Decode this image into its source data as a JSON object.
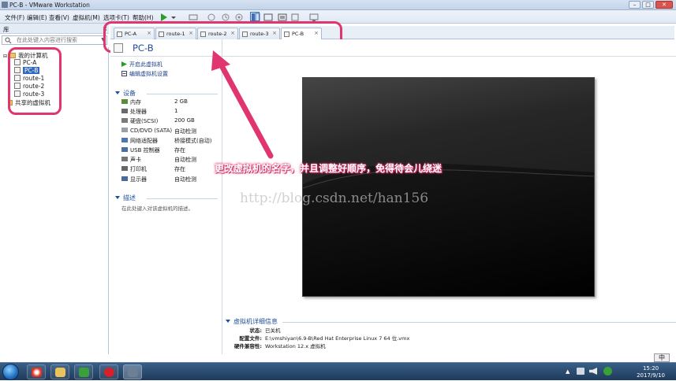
{
  "window": {
    "title": "PC-B - VMware Workstation"
  },
  "menu": [
    "文件(F)",
    "编辑(E)",
    "查看(V)",
    "虚拟机(M)",
    "选项卡(T)",
    "帮助(H)"
  ],
  "sidebar": {
    "header": "库",
    "close": "×",
    "search_placeholder": "在此处键入内容进行搜索",
    "root": "我的计算机",
    "vms": [
      "PC-A",
      "PC-B",
      "route-1",
      "route-2",
      "route-3"
    ],
    "selected": "PC-B",
    "shared": "共享的虚拟机"
  },
  "tabs": [
    {
      "label": "PC-A",
      "close": "×"
    },
    {
      "label": "route-1",
      "close": "×"
    },
    {
      "label": "route-2",
      "close": "×"
    },
    {
      "label": "route-3",
      "close": "×"
    },
    {
      "label": "PC-B",
      "close": "×",
      "active": true
    }
  ],
  "vm": {
    "name": "PC-B",
    "actions": [
      "开启此虚拟机",
      "编辑虚拟机设置"
    ],
    "devices_title": "设备",
    "devices": [
      {
        "icon": "memory-icon",
        "name": "内存",
        "value": "2 GB"
      },
      {
        "icon": "cpu-icon",
        "name": "处理器",
        "value": "1"
      },
      {
        "icon": "hdd-icon",
        "name": "硬盘(SCSI)",
        "value": "200 GB"
      },
      {
        "icon": "cdrom-icon",
        "name": "CD/DVD (SATA)",
        "value": "自动检测"
      },
      {
        "icon": "network-icon",
        "name": "网络适配器",
        "value": "桥接模式(自动)"
      },
      {
        "icon": "usb-icon",
        "name": "USB 控制器",
        "value": "存在"
      },
      {
        "icon": "sound-icon",
        "name": "声卡",
        "value": "自动检测"
      },
      {
        "icon": "printer-icon",
        "name": "打印机",
        "value": "存在"
      },
      {
        "icon": "display-icon",
        "name": "显示器",
        "value": "自动检测"
      }
    ],
    "desc_title": "描述",
    "desc_placeholder": "在此处键入对该虚拟机的描述。",
    "details_title": "虚拟机详细信息",
    "details": [
      {
        "label": "状态:",
        "value": "已关机"
      },
      {
        "label": "配置文件:",
        "value": "E:\\vmshiyan\\6.9-B\\Red Hat Enterprise Linux 7 64 位.vmx"
      },
      {
        "label": "硬件兼容性:",
        "value": "Workstation 12.x 虚拟机"
      }
    ]
  },
  "annotation": "更改虚拟机的名字，并且调整好顺序，免得待会儿绕迷",
  "watermark": "http://blog.csdn.net/han156",
  "taskbar": {
    "ime": "中",
    "time": "15:20",
    "date": "2017/9/10"
  },
  "colors": {
    "highlight": "#e0356e",
    "accent": "#1f4f9b",
    "selection": "#3168c4"
  }
}
